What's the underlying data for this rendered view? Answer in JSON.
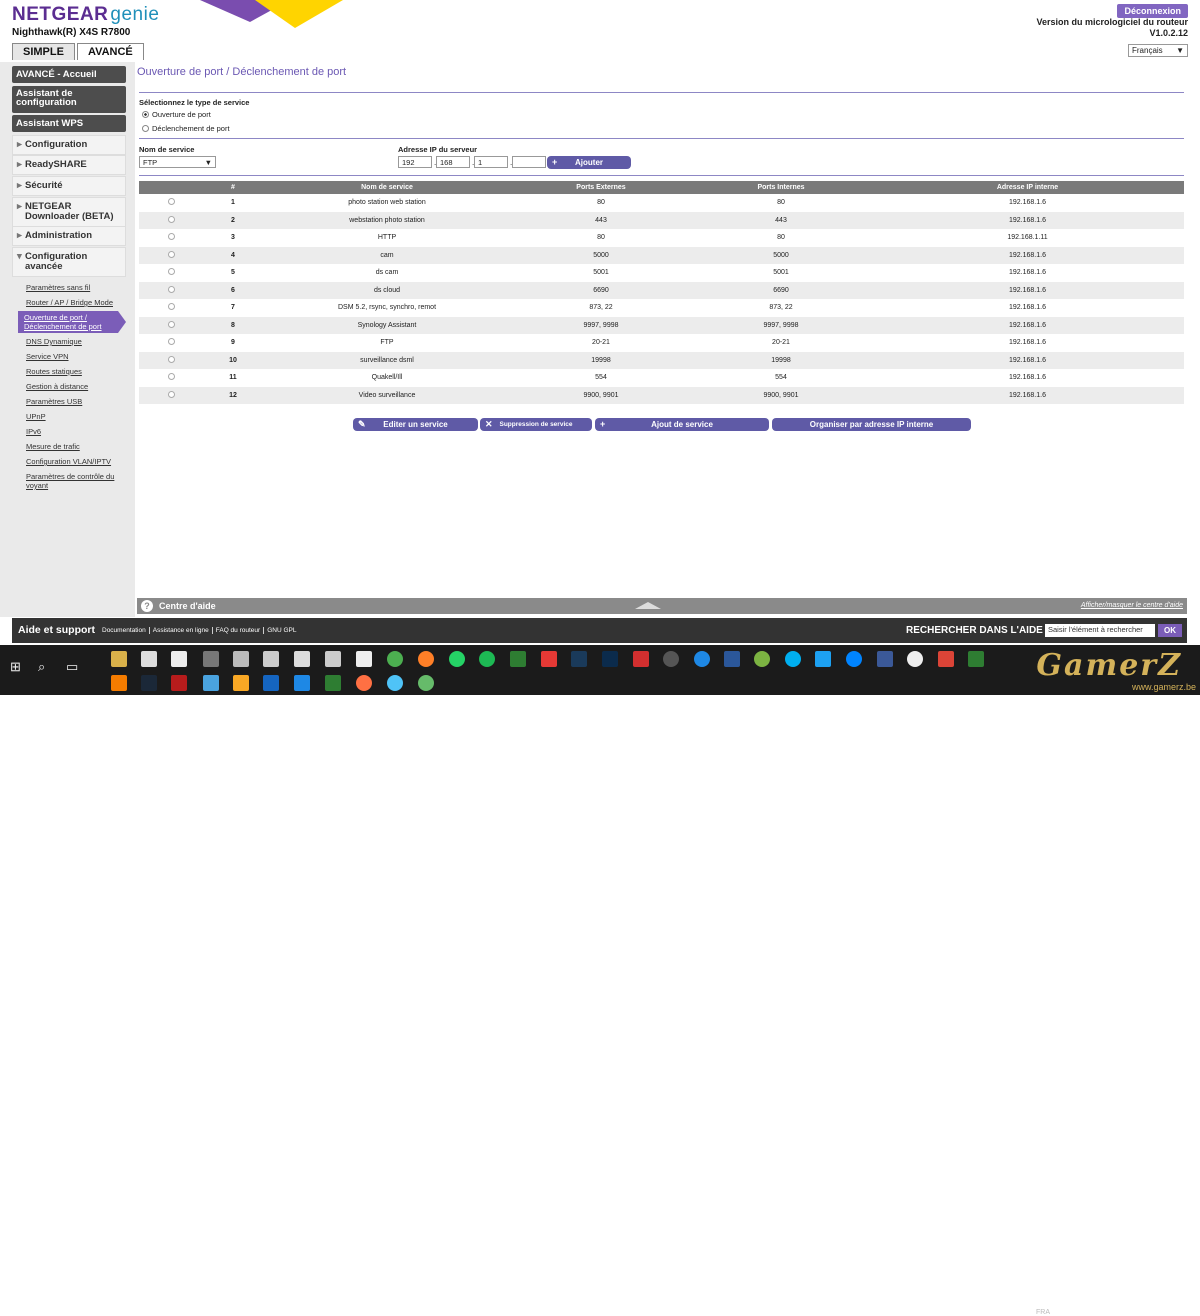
{
  "header": {
    "brand": "NETGEAR",
    "brand_suffix": "genie",
    "model": "Nighthawk(R) X4S R7800",
    "logout_label": "Déconnexion",
    "firmware_label": "Version du micrologiciel du routeur",
    "firmware_version": "V1.0.2.12",
    "tabs": [
      "SIMPLE",
      "AVANCÉ"
    ],
    "language": "Français"
  },
  "sidebar": {
    "buttons": [
      "AVANCÉ - Accueil",
      "Assistant de configuration",
      "Assistant WPS"
    ],
    "items": [
      "Configuration",
      "ReadySHARE",
      "Sécurité",
      "NETGEAR Downloader (BETA)",
      "Administration",
      "Configuration avancée"
    ],
    "sublinks": [
      "Paramètres sans fil",
      "Router / AP / Bridge Mode",
      "Ouverture de port / Déclenchement de port",
      "DNS Dynamique",
      "Service VPN",
      "Routes statiques",
      "Gestion à distance",
      "Paramètres USB",
      "UPnP",
      "IPv6",
      "Mesure de trafic",
      "Configuration VLAN/IPTV",
      "Paramètres de contrôle du voyant"
    ]
  },
  "main": {
    "title": "Ouverture de port / Déclenchement de port",
    "service_type_label": "Sélectionnez le type de service",
    "radio_open": "Ouverture de port",
    "radio_trigger": "Déclenchement de port",
    "service_name_label": "Nom de service",
    "service_name_value": "FTP",
    "server_ip_label": "Adresse IP du serveur",
    "ip": [
      "192",
      "168",
      "1",
      ""
    ],
    "add_label": "Ajouter",
    "table": {
      "headers": [
        "#",
        "Nom de service",
        "Ports Externes",
        "Ports Internes",
        "Adresse IP interne"
      ],
      "rows": [
        [
          "1",
          "photo station web station",
          "80",
          "80",
          "192.168.1.6"
        ],
        [
          "2",
          "webstation photo station",
          "443",
          "443",
          "192.168.1.6"
        ],
        [
          "3",
          "HTTP",
          "80",
          "80",
          "192.168.1.11"
        ],
        [
          "4",
          "cam",
          "5000",
          "5000",
          "192.168.1.6"
        ],
        [
          "5",
          "ds cam",
          "5001",
          "5001",
          "192.168.1.6"
        ],
        [
          "6",
          "ds cloud",
          "6690",
          "6690",
          "192.168.1.6"
        ],
        [
          "7",
          "DSM 5.2, rsync, synchro, remot",
          "873, 22",
          "873, 22",
          "192.168.1.6"
        ],
        [
          "8",
          "Synology Assistant",
          "9997, 9998",
          "9997, 9998",
          "192.168.1.6"
        ],
        [
          "9",
          "FTP",
          "20-21",
          "20-21",
          "192.168.1.6"
        ],
        [
          "10",
          "surveillance dsml",
          "19998",
          "19998",
          "192.168.1.6"
        ],
        [
          "11",
          "Quakell/Ill",
          "554",
          "554",
          "192.168.1.6"
        ],
        [
          "12",
          "Video surveillance",
          "9900, 9901",
          "9900, 9901",
          "192.168.1.6"
        ]
      ]
    },
    "actions": [
      "Editer un service",
      "Suppression de service",
      "Ajout de service",
      "Organiser par adresse IP interne"
    ]
  },
  "help": {
    "title": "Centre d'aide",
    "toggle": "Afficher/masquer le centre d'aide"
  },
  "footer": {
    "title": "Aide et support",
    "links": [
      "Documentation",
      "Assistance en ligne",
      "FAQ du routeur",
      "GNU GPL"
    ],
    "search_label": "RECHERCHER DANS L'AIDE",
    "search_placeholder": "Saisir l'élément à rechercher",
    "ok_label": "OK"
  },
  "taskbar": {
    "tray_lang": "FRA",
    "watermark": "GamerZ",
    "watermark_sub": "www.gamerz.be"
  },
  "colors": {
    "brand_purple": "#5b2d91",
    "accent": "#7b5db8",
    "button": "#5f5aa6"
  }
}
